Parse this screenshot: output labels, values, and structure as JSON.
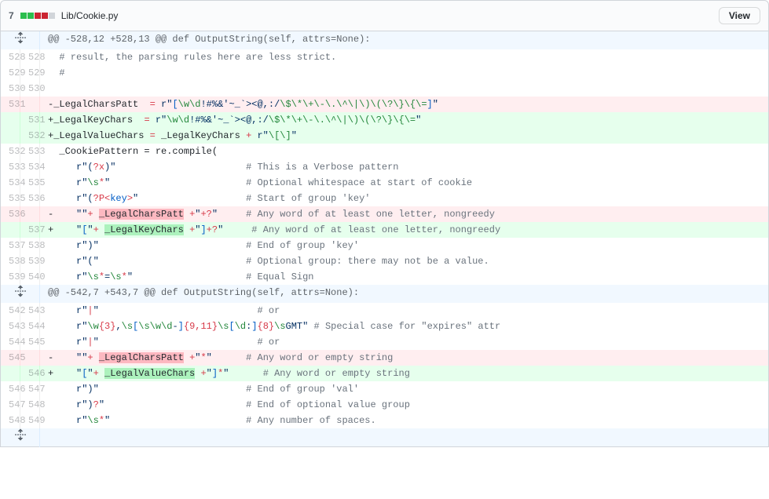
{
  "header": {
    "diff_count": "7",
    "file_path": "Lib/Cookie.py",
    "view_label": "View"
  },
  "hunks": {
    "h1": "@@ -528,12 +528,13 @@ def OutputString(self, attrs=None):",
    "h2": "@@ -542,7 +543,7 @@ def OutputString(self, attrs=None):"
  },
  "lines": {
    "l528": {
      "old": "528",
      "new": "528"
    },
    "l529": {
      "old": "529",
      "new": "529"
    },
    "l530": {
      "old": "530",
      "new": "530"
    },
    "l531d": {
      "old": "531",
      "new": ""
    },
    "l531a": {
      "old": "",
      "new": "531"
    },
    "l532a": {
      "old": "",
      "new": "532"
    },
    "l533": {
      "old": "532",
      "new": "533"
    },
    "l534": {
      "old": "533",
      "new": "534"
    },
    "l535": {
      "old": "534",
      "new": "535"
    },
    "l536": {
      "old": "535",
      "new": "536"
    },
    "l536d": {
      "old": "536",
      "new": ""
    },
    "l537a": {
      "old": "",
      "new": "537"
    },
    "l538": {
      "old": "537",
      "new": "538"
    },
    "l539": {
      "old": "538",
      "new": "539"
    },
    "l540": {
      "old": "539",
      "new": "540"
    },
    "l543": {
      "old": "542",
      "new": "543"
    },
    "l544": {
      "old": "543",
      "new": "544"
    },
    "l545": {
      "old": "544",
      "new": "545"
    },
    "l545d": {
      "old": "545",
      "new": ""
    },
    "l546a": {
      "old": "",
      "new": "546"
    },
    "l547": {
      "old": "546",
      "new": "547"
    },
    "l548": {
      "old": "547",
      "new": "548"
    },
    "l549": {
      "old": "548",
      "new": "549"
    }
  },
  "code": {
    "c528": " # result, the parsing rules here are less strict.",
    "c529": " #",
    "c530": "",
    "c533": " _CookiePattern = re.compile(",
    "comment_verbose": "# This is a Verbose pattern",
    "comment_whitespace": "# Optional whitespace at start of cookie",
    "comment_startkey": "# Start of group 'key'",
    "comment_anyword": "# Any word of at least one letter, nongreedy",
    "comment_endkey": "# End of group 'key'",
    "comment_optgroup": "# Optional group: there may not be a value.",
    "comment_equal": "# Equal Sign",
    "comment_or": "# or",
    "comment_expires": "# Special case for \"expires\" attr",
    "comment_anyempty": "# Any word or empty string",
    "comment_endval": "# End of group 'val'",
    "comment_endopt": "# End of optional value group",
    "comment_spaces": "# Any number of spaces.",
    "var_legalcharspatt": "_LegalCharsPatt",
    "var_legalkeychars": "_LegalKeyChars",
    "var_legalvaluechars": "_LegalValueChars"
  }
}
